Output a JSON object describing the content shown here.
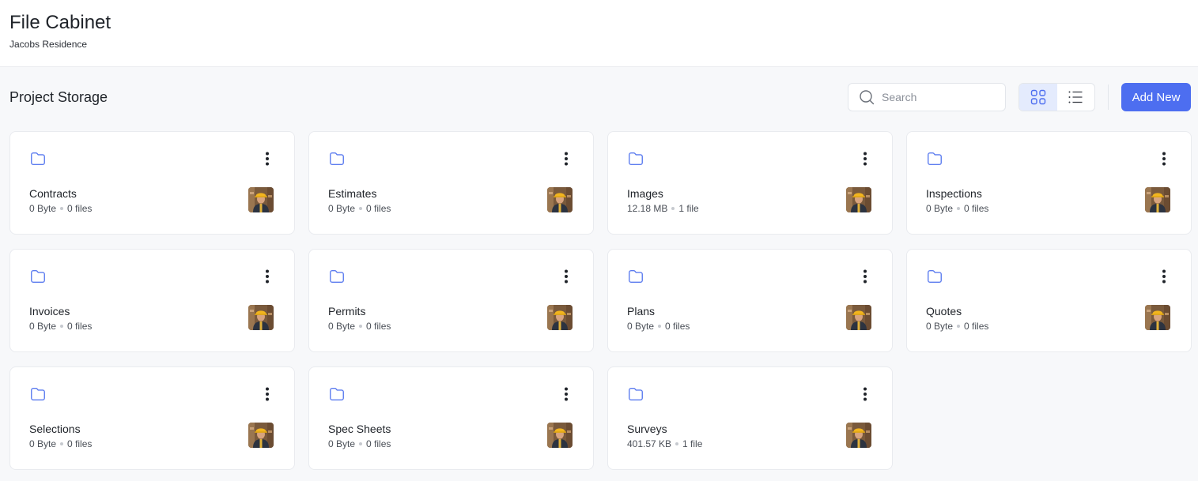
{
  "header": {
    "title": "File Cabinet",
    "subtitle": "Jacobs Residence"
  },
  "toolbar": {
    "section_title": "Project Storage",
    "search_placeholder": "Search",
    "view_mode": "grid",
    "add_new_label": "Add New"
  },
  "colors": {
    "accent": "#4d6ef0",
    "folder_icon": "#5b7bef"
  },
  "folders": [
    {
      "name": "Contracts",
      "size": "0 Byte",
      "count": "0 files"
    },
    {
      "name": "Estimates",
      "size": "0 Byte",
      "count": "0 files"
    },
    {
      "name": "Images",
      "size": "12.18 MB",
      "count": "1 file"
    },
    {
      "name": "Inspections",
      "size": "0 Byte",
      "count": "0 files"
    },
    {
      "name": "Invoices",
      "size": "0 Byte",
      "count": "0 files"
    },
    {
      "name": "Permits",
      "size": "0 Byte",
      "count": "0 files"
    },
    {
      "name": "Plans",
      "size": "0 Byte",
      "count": "0 files"
    },
    {
      "name": "Quotes",
      "size": "0 Byte",
      "count": "0 files"
    },
    {
      "name": "Selections",
      "size": "0 Byte",
      "count": "0 files"
    },
    {
      "name": "Spec Sheets",
      "size": "0 Byte",
      "count": "0 files"
    },
    {
      "name": "Surveys",
      "size": "401.57 KB",
      "count": "1 file"
    }
  ]
}
